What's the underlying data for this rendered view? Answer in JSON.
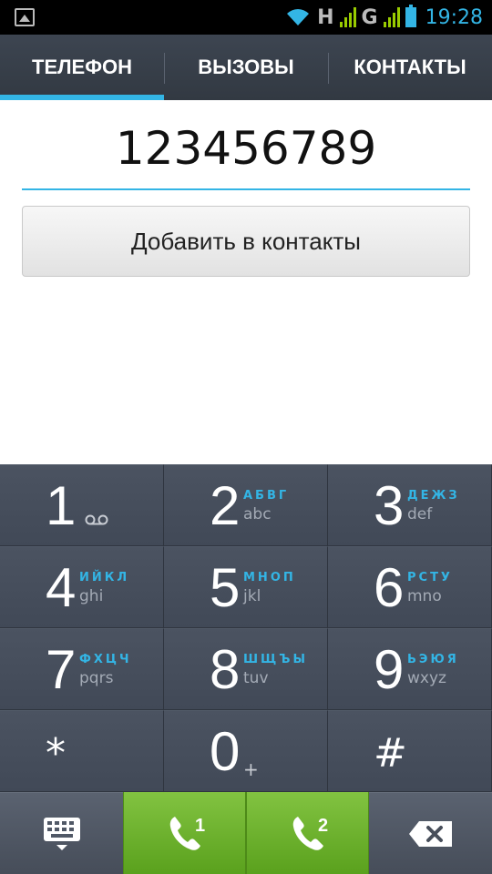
{
  "status_bar": {
    "time": "19:28",
    "network_1": "H",
    "network_2": "G",
    "colors": {
      "accent": "#33b5e5",
      "signal": "#99cc00"
    }
  },
  "tabs": [
    {
      "label": "ТЕЛЕФОН",
      "active": true
    },
    {
      "label": "ВЫЗОВЫ",
      "active": false
    },
    {
      "label": "КОНТАКТЫ",
      "active": false
    }
  ],
  "dialer": {
    "number": "123456789",
    "add_contact_label": "Добавить в контакты"
  },
  "keypad": {
    "keys": [
      {
        "digit": "1",
        "ru": "",
        "en": "",
        "icon": "voicemail-icon"
      },
      {
        "digit": "2",
        "ru": "АБВГ",
        "en": "abc"
      },
      {
        "digit": "3",
        "ru": "ДЕЖЗ",
        "en": "def"
      },
      {
        "digit": "4",
        "ru": "ИЙКЛ",
        "en": "ghi"
      },
      {
        "digit": "5",
        "ru": "МНОП",
        "en": "jkl"
      },
      {
        "digit": "6",
        "ru": "РСТУ",
        "en": "mno"
      },
      {
        "digit": "7",
        "ru": "ФХЦЧ",
        "en": "pqrs"
      },
      {
        "digit": "8",
        "ru": "ШЩЪЫ",
        "en": "tuv"
      },
      {
        "digit": "9",
        "ru": "ЬЭЮЯ",
        "en": "wxyz"
      },
      {
        "digit": "*",
        "ru": "",
        "en": ""
      },
      {
        "digit": "0",
        "ru": "",
        "en": "+"
      },
      {
        "digit": "#",
        "ru": "",
        "en": ""
      }
    ]
  },
  "bottom_bar": {
    "sim1_label": "1",
    "sim2_label": "2",
    "icons": [
      "keyboard-toggle-icon",
      "call-sim1-icon",
      "call-sim2-icon",
      "backspace-icon"
    ],
    "call_color": "#6cb52d"
  }
}
